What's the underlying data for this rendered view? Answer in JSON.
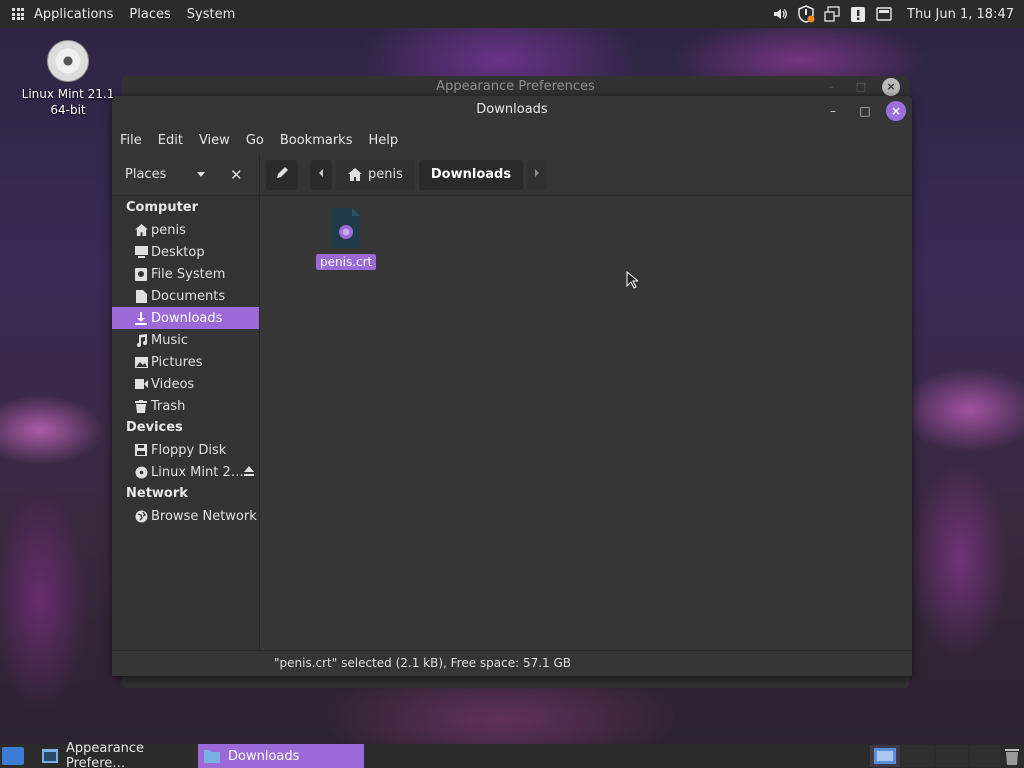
{
  "top_panel": {
    "menus": [
      "Applications",
      "Places",
      "System"
    ],
    "clock": "Thu Jun  1, 18:47",
    "tray_icons": [
      "volume-icon",
      "shield-update-icon",
      "network-icon",
      "clipboard-alert-icon",
      "battery-icon"
    ]
  },
  "desktop": {
    "icon_label_line1": "Linux Mint 21.1",
    "icon_label_line2": "64-bit"
  },
  "background_window": {
    "title": "Appearance Preferences"
  },
  "window": {
    "title": "Downloads",
    "menu": [
      "File",
      "Edit",
      "View",
      "Go",
      "Bookmarks",
      "Help"
    ],
    "places_label": "Places",
    "breadcrumbs": [
      "penis",
      "Downloads"
    ],
    "sidebar": {
      "sections": [
        {
          "title": "Computer",
          "items": [
            {
              "label": "penis",
              "icon": "home-icon"
            },
            {
              "label": "Desktop",
              "icon": "desktop-icon"
            },
            {
              "label": "File System",
              "icon": "drive-icon"
            },
            {
              "label": "Documents",
              "icon": "document-icon"
            },
            {
              "label": "Downloads",
              "icon": "download-icon",
              "selected": true
            },
            {
              "label": "Music",
              "icon": "music-icon"
            },
            {
              "label": "Pictures",
              "icon": "picture-icon"
            },
            {
              "label": "Videos",
              "icon": "video-icon"
            },
            {
              "label": "Trash",
              "icon": "trash-icon"
            }
          ]
        },
        {
          "title": "Devices",
          "items": [
            {
              "label": "Floppy Disk",
              "icon": "floppy-icon"
            },
            {
              "label": "Linux Mint 2…",
              "icon": "disc-icon",
              "eject": true
            }
          ]
        },
        {
          "title": "Network",
          "items": [
            {
              "label": "Browse Network",
              "icon": "network-globe-icon"
            }
          ]
        }
      ]
    },
    "files": [
      {
        "name": "penis.crt",
        "icon": "certificate-icon",
        "selected": true
      }
    ],
    "status": "\"penis.crt\" selected (2.1 kB), Free space: 57.1 GB"
  },
  "taskbar": {
    "tasks": [
      {
        "label": "Appearance Prefere…",
        "active": false
      },
      {
        "label": "Downloads",
        "active": true
      }
    ]
  },
  "colors": {
    "accent": "#9b6ad8",
    "panel": "#2b2b2b",
    "window_bg": "#353535"
  }
}
